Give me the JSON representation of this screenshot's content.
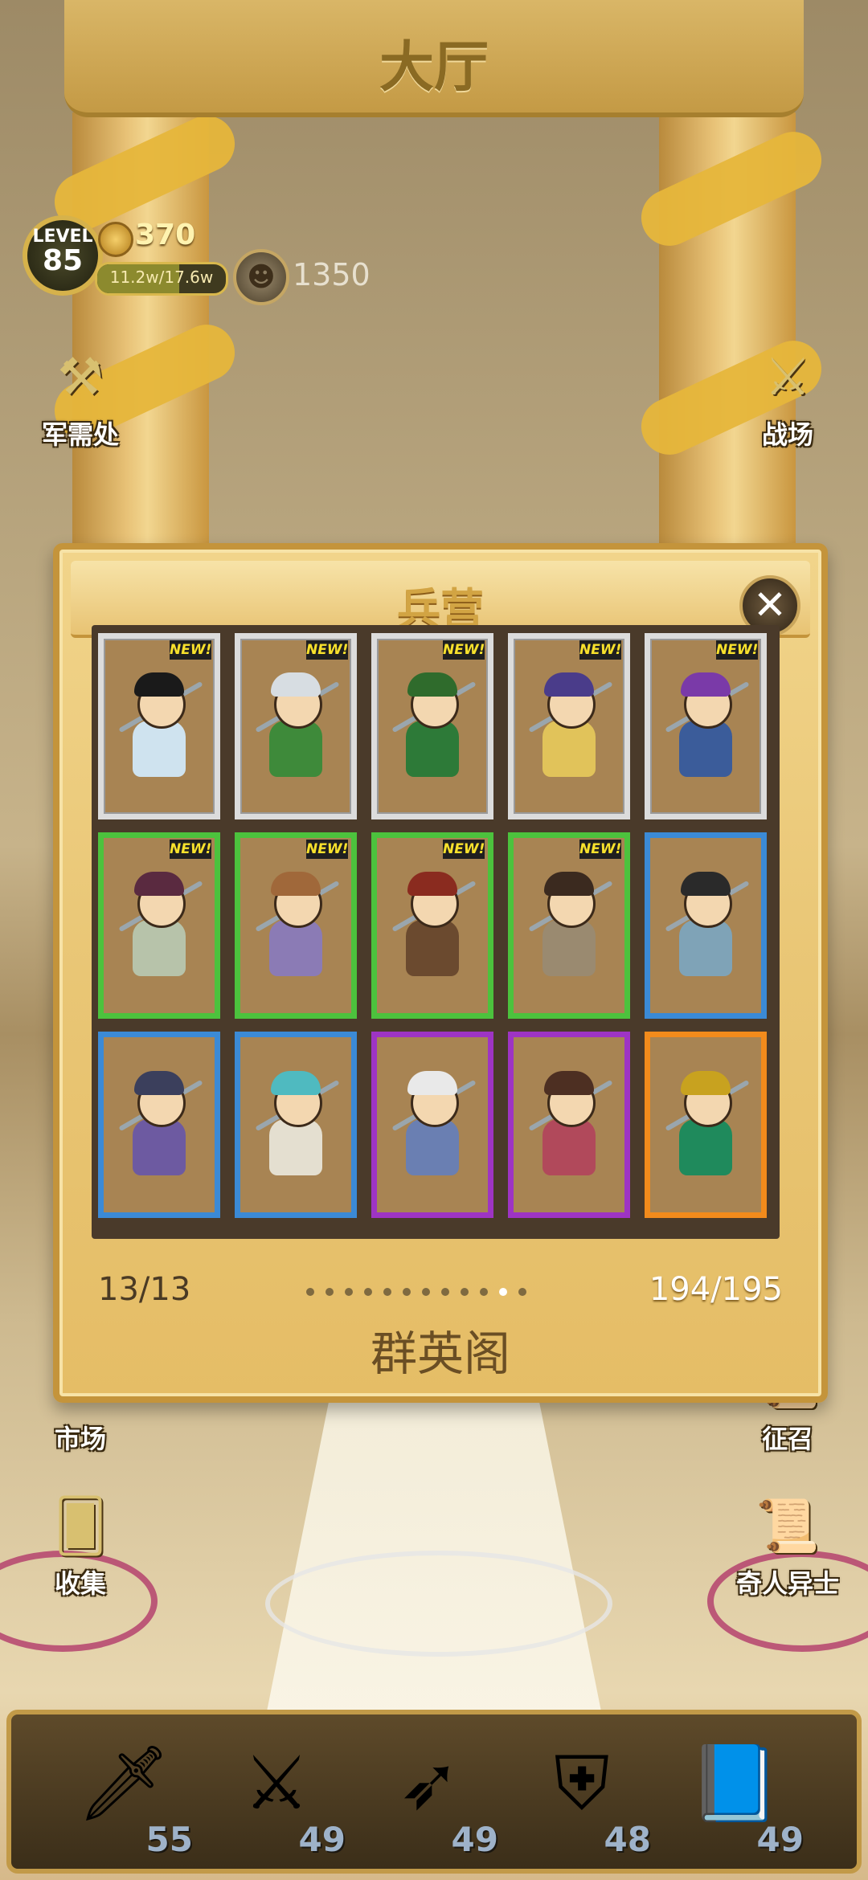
{
  "header": {
    "title": "大厅"
  },
  "hud": {
    "level_label": "LEVEL",
    "level_value": "85",
    "coins": "370",
    "exp_text": "11.2w/17.6w",
    "exp_fraction": 0.64,
    "currency2": "1350"
  },
  "side_buttons": {
    "shop": "军需处",
    "battle": "战场",
    "market": "市场",
    "recruit": "征召",
    "collect": "收集",
    "special": "奇人异士"
  },
  "dialog": {
    "title": "兵营",
    "close_label": "✕",
    "new_label": "NEW!",
    "page_left": "13/13",
    "page_right": "194/195",
    "section_name": "群英阁",
    "dots_total": 12,
    "dots_active": 11,
    "cards": [
      {
        "rarity": "grey",
        "new": true,
        "hair": "#1a1a1a",
        "body": "#cfe3ef"
      },
      {
        "rarity": "grey",
        "new": true,
        "hair": "#d7dde2",
        "body": "#3e8a3a"
      },
      {
        "rarity": "grey",
        "new": true,
        "hair": "#2f6b2c",
        "body": "#2d7a38"
      },
      {
        "rarity": "grey",
        "new": true,
        "hair": "#4a3c8a",
        "body": "#e1c35a"
      },
      {
        "rarity": "grey",
        "new": true,
        "hair": "#7a3aa8",
        "body": "#3b5c9a"
      },
      {
        "rarity": "green",
        "new": true,
        "hair": "#5a2a40",
        "body": "#b7c3aa"
      },
      {
        "rarity": "green",
        "new": true,
        "hair": "#a0683a",
        "body": "#8b7bb5"
      },
      {
        "rarity": "green",
        "new": true,
        "hair": "#8a2b1f",
        "body": "#6b4a2f"
      },
      {
        "rarity": "green",
        "new": true,
        "hair": "#3b2a1f",
        "body": "#9a8a70"
      },
      {
        "rarity": "blue",
        "new": false,
        "hair": "#2a2a2a",
        "body": "#7fa3b7"
      },
      {
        "rarity": "blue",
        "new": false,
        "hair": "#3b3f5c",
        "body": "#6d5aa1"
      },
      {
        "rarity": "blue",
        "new": false,
        "hair": "#4fbac0",
        "body": "#e4dfd0"
      },
      {
        "rarity": "purple",
        "new": false,
        "hair": "#e9e9e9",
        "body": "#6a7fb2"
      },
      {
        "rarity": "purple",
        "new": false,
        "hair": "#4d2f22",
        "body": "#b1495b"
      },
      {
        "rarity": "orange",
        "new": false,
        "hair": "#c8a21f",
        "body": "#1f8a5c"
      }
    ]
  },
  "inventory": [
    {
      "icon": "sword-icon",
      "glyph": "🗡",
      "count": "55"
    },
    {
      "icon": "broadsword-icon",
      "glyph": "⚔",
      "count": "49"
    },
    {
      "icon": "spear-icon",
      "glyph": "➶",
      "count": "49"
    },
    {
      "icon": "armor-icon",
      "glyph": "⛨",
      "count": "48"
    },
    {
      "icon": "book-icon",
      "glyph": "📘",
      "count": "49"
    }
  ],
  "colors": {
    "grey": "#dcdcdc",
    "green": "#4cc23d",
    "blue": "#3b8ad6",
    "purple": "#9e34c4",
    "orange": "#f28b1c"
  }
}
